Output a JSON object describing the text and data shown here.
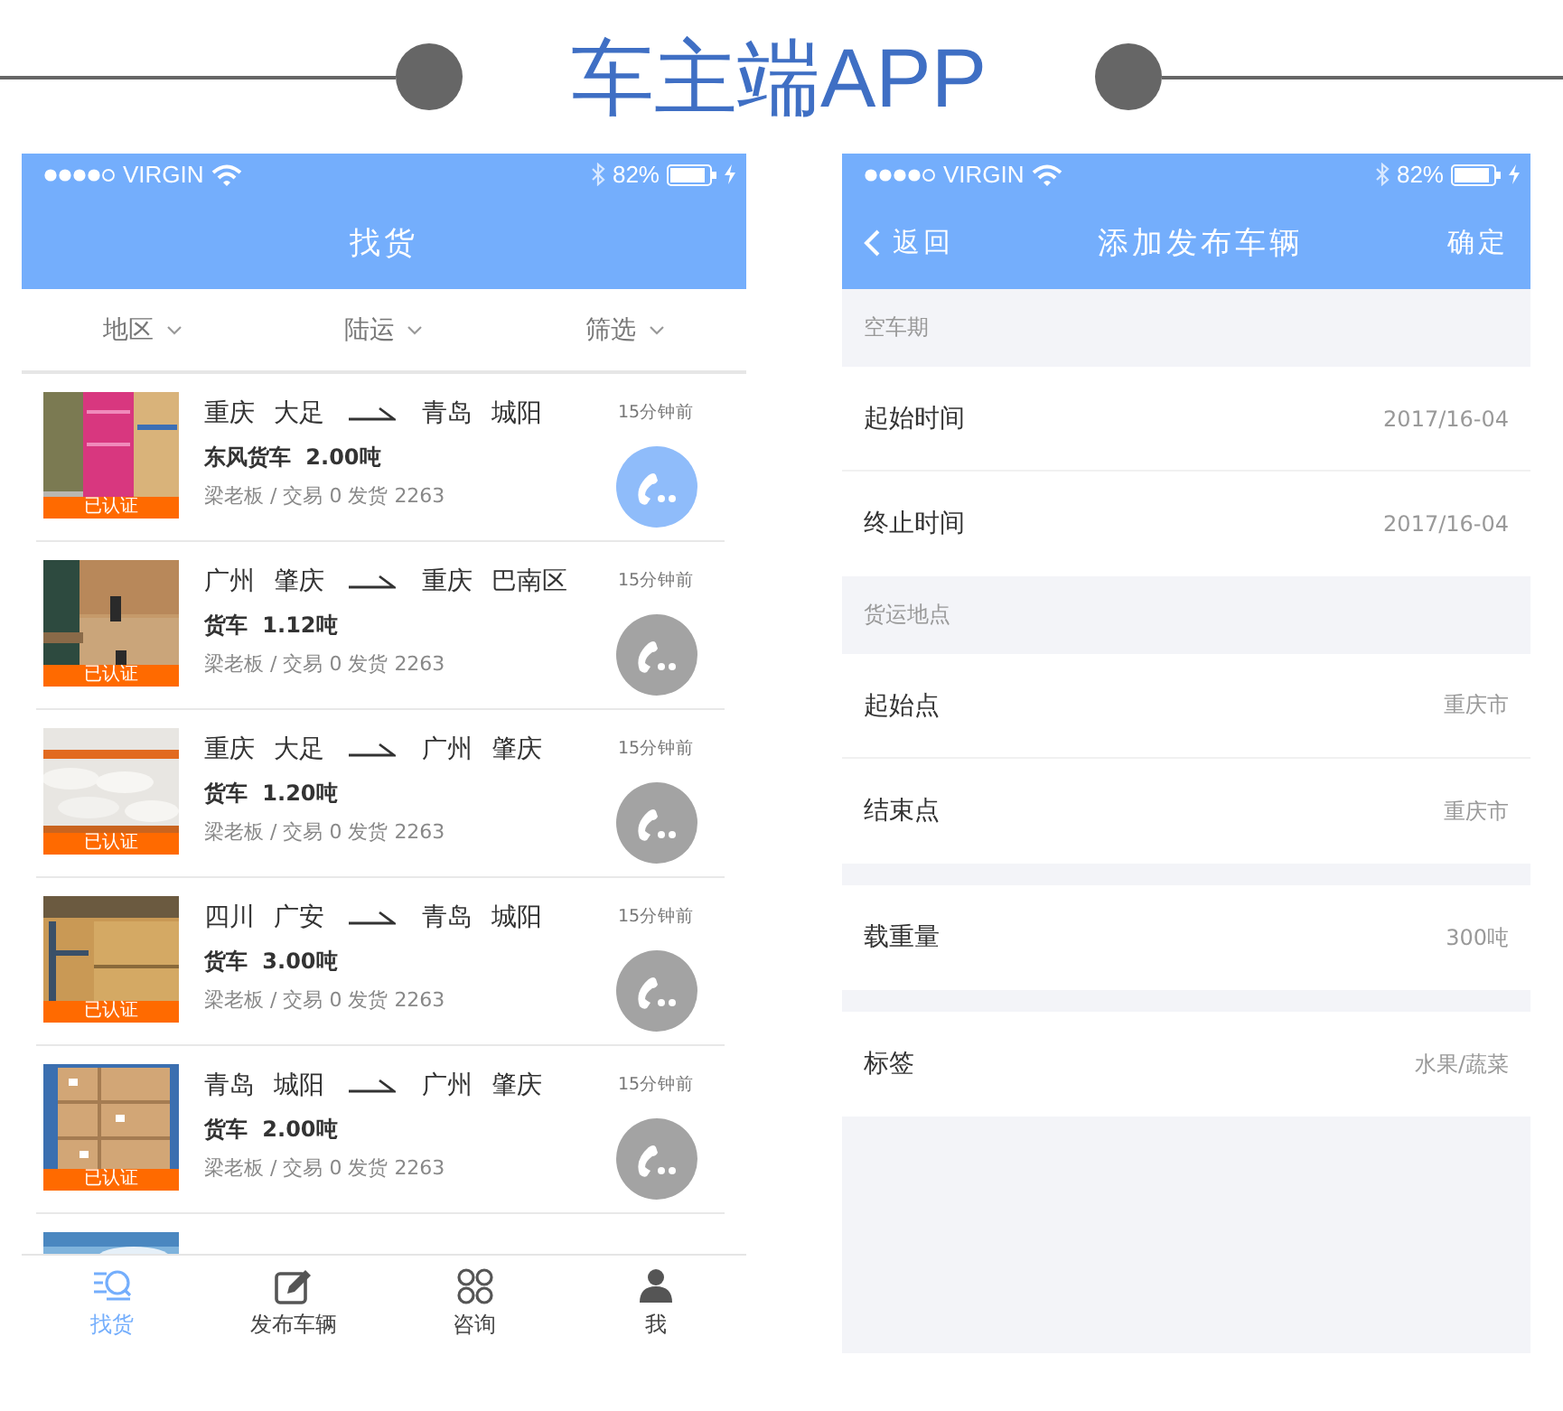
{
  "banner": {
    "title": "车主端APP"
  },
  "cargo_screen": {
    "status_bar": {
      "carrier": "VIRGIN",
      "battery": "82%"
    },
    "title": "找货",
    "filters": [
      {
        "label": "地区"
      },
      {
        "label": "陆运"
      },
      {
        "label": "筛选"
      }
    ],
    "listings": [
      {
        "from": "重庆 大足",
        "to": "青岛 城阳",
        "truck": "东风货车 2.00吨",
        "meta": "梁老板 / 交易 0 发货 2263",
        "time": "15分钟前",
        "badge": "已认证",
        "call_highlighted": true
      },
      {
        "from": "广州 肇庆",
        "to": "重庆 巴南区",
        "truck": "货车 1.12吨",
        "meta": "梁老板 / 交易 0 发货 2263",
        "time": "15分钟前",
        "badge": "已认证",
        "call_highlighted": false
      },
      {
        "from": "重庆 大足",
        "to": "广州 肇庆",
        "truck": "货车 1.20吨",
        "meta": "梁老板 / 交易 0 发货 2263",
        "time": "15分钟前",
        "badge": "已认证",
        "call_highlighted": false
      },
      {
        "from": "四川 广安",
        "to": "青岛 城阳",
        "truck": "货车 3.00吨",
        "meta": "梁老板 / 交易 0 发货 2263",
        "time": "15分钟前",
        "badge": "已认证",
        "call_highlighted": false
      },
      {
        "from": "青岛 城阳",
        "to": "广州 肇庆",
        "truck": "货车 2.00吨",
        "meta": "梁老板 / 交易 0 发货 2263",
        "time": "15分钟前",
        "badge": "已认证",
        "call_highlighted": false
      }
    ],
    "tabs": [
      {
        "label": "找货",
        "selected": true
      },
      {
        "label": "发布车辆",
        "selected": false
      },
      {
        "label": "咨询",
        "selected": false
      },
      {
        "label": "我",
        "selected": false
      }
    ]
  },
  "vehicle_screen": {
    "status_bar": {
      "carrier": "VIRGIN",
      "battery": "82%"
    },
    "back": "返回",
    "title": "添加发布车辆",
    "confirm": "确定",
    "sections": [
      {
        "header": "空车期",
        "rows": [
          {
            "label": "起始时间",
            "value": "2017/16-04"
          },
          {
            "label": "终止时间",
            "value": "2017/16-04"
          }
        ]
      },
      {
        "header": "货运地点",
        "rows": [
          {
            "label": "起始点",
            "value": "重庆市"
          },
          {
            "label": "结束点",
            "value": "重庆市"
          }
        ]
      },
      {
        "rows": [
          {
            "label": "载重量",
            "value": "300吨"
          }
        ]
      },
      {
        "rows": [
          {
            "label": "标签",
            "value": "水果/蔬菜"
          }
        ]
      }
    ]
  }
}
